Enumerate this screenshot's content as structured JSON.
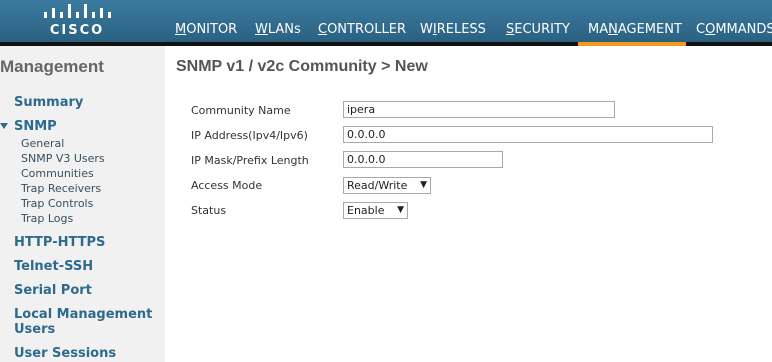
{
  "brand": {
    "logo_text": "CISCO"
  },
  "nav": {
    "items": [
      {
        "label": "MONITOR",
        "underline": "M",
        "rest": "ONITOR"
      },
      {
        "label": "WLANs",
        "underline": "W",
        "rest": "LANs"
      },
      {
        "label": "CONTROLLER",
        "underline": "C",
        "rest": "ONTROLLER"
      },
      {
        "label": "WIRELESS",
        "first": "W",
        "underline": "I",
        "rest": "RELESS"
      },
      {
        "label": "SECURITY",
        "underline": "S",
        "rest": "ECURITY"
      },
      {
        "label": "MANAGEMENT",
        "first": "MA",
        "underline": "N",
        "rest": "AGEMENT"
      },
      {
        "label": "COMMANDS",
        "first": "C",
        "underline": "O",
        "rest": "MMANDS"
      }
    ],
    "active": "MANAGEMENT",
    "accent_color": "#f39a1e"
  },
  "sidebar": {
    "title": "Management",
    "items": {
      "summary": "Summary",
      "snmp": "SNMP",
      "general": "General",
      "snmp_v3_users": "SNMP V3 Users",
      "communities": "Communities",
      "trap_receivers": "Trap Receivers",
      "trap_controls": "Trap Controls",
      "trap_logs": "Trap Logs",
      "http_https": "HTTP-HTTPS",
      "telnet_ssh": "Telnet-SSH",
      "serial_port": "Serial Port",
      "local_mgmt_line1": "Local Management",
      "local_mgmt_line2": "Users",
      "user_sessions": "User Sessions"
    }
  },
  "page": {
    "title": "SNMP v1 / v2c Community > New"
  },
  "form": {
    "community_name": {
      "label": "Community Name",
      "value": "ipera"
    },
    "ip_address": {
      "label": "IP Address(Ipv4/Ipv6)",
      "value": "0.0.0.0"
    },
    "ip_mask": {
      "label": "IP Mask/Prefix Length",
      "value": "0.0.0.0"
    },
    "access_mode": {
      "label": "Access Mode",
      "value": "Read/Write"
    },
    "status": {
      "label": "Status",
      "value": "Enable"
    }
  }
}
